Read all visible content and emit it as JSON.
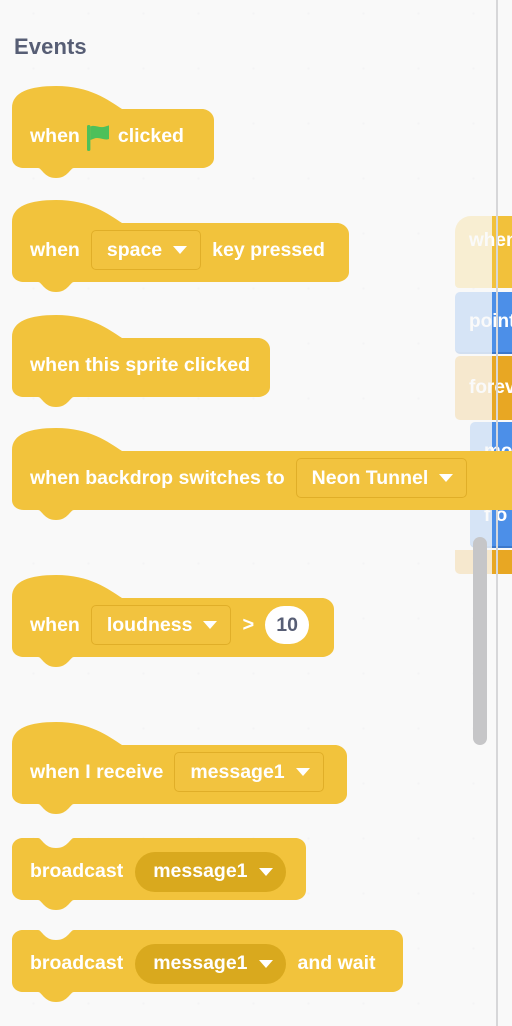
{
  "palette": {
    "category_title": "Events",
    "background_color": "#f9f9f9",
    "block_color": "#f2c33c",
    "dropdown_color": "#d9a91e",
    "title_color": "#575e75"
  },
  "blocks": [
    {
      "id": "when-flag-clicked",
      "kind": "hat",
      "text_before": "when",
      "icon": "green-flag-icon",
      "text_after": "clicked"
    },
    {
      "id": "when-key-pressed",
      "kind": "hat",
      "text_before": "when",
      "dropdown_value": "space",
      "text_after": "key pressed"
    },
    {
      "id": "when-this-sprite-clicked",
      "kind": "hat",
      "text_before": "when this sprite clicked"
    },
    {
      "id": "when-backdrop-switches-to",
      "kind": "hat",
      "text_before": "when backdrop switches to",
      "dropdown_value": "Neon Tunnel"
    },
    {
      "id": "when-loudness-greater-than",
      "kind": "hat",
      "text_before": "when",
      "dropdown_value": "loudness",
      "operator": ">",
      "number_value": "10"
    },
    {
      "id": "when-i-receive",
      "kind": "hat",
      "text_before": "when I receive",
      "dropdown_value": "message1"
    },
    {
      "id": "broadcast",
      "kind": "stack",
      "text_before": "broadcast",
      "dropdown_value": "message1"
    },
    {
      "id": "broadcast-and-wait",
      "kind": "stack",
      "text_before": "broadcast",
      "dropdown_value": "message1",
      "text_after": "and wait"
    }
  ],
  "workspace_script": [
    {
      "id": "ws-when-hat",
      "label": "when",
      "type": "events"
    },
    {
      "id": "ws-point",
      "label": "point",
      "type": "motion"
    },
    {
      "id": "ws-forever",
      "label": "forev",
      "type": "control"
    },
    {
      "id": "ws-move",
      "label": "mo",
      "type": "motion"
    },
    {
      "id": "ws-if-on",
      "label": "f o",
      "type": "motion"
    }
  ],
  "scrollbar": {
    "name": "vertical-scrollbar"
  }
}
